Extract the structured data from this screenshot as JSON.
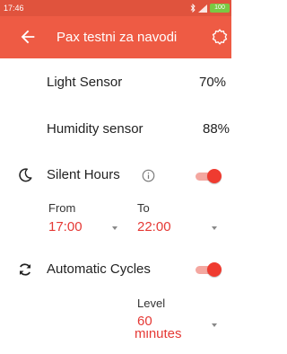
{
  "status_bar": {
    "time": "17:46",
    "battery": "100"
  },
  "app_bar": {
    "title": "Pax testni za navodi"
  },
  "sensors": [
    {
      "label": "Light Sensor",
      "value": "70%"
    },
    {
      "label": "Humidity sensor",
      "value": "88%"
    }
  ],
  "silent_hours": {
    "label": "Silent Hours",
    "enabled": true,
    "from_label": "From",
    "from_value": "17:00",
    "to_label": "To",
    "to_value": "22:00"
  },
  "automatic_cycles": {
    "label": "Automatic Cycles",
    "enabled": true,
    "level_label": "Level",
    "level_value_line1": "60",
    "level_value_line2": "minutes"
  },
  "colors": {
    "app_bar": "#ee5b44",
    "status_bar": "#e0533d",
    "accent": "#e53935",
    "toggle_thumb": "#ef3b30"
  },
  "icons": [
    "back-arrow-icon",
    "settings-gear-icon",
    "moon-icon",
    "info-icon",
    "refresh-cycle-icon",
    "dropdown-arrow-icon",
    "bluetooth-icon",
    "signal-icon"
  ]
}
